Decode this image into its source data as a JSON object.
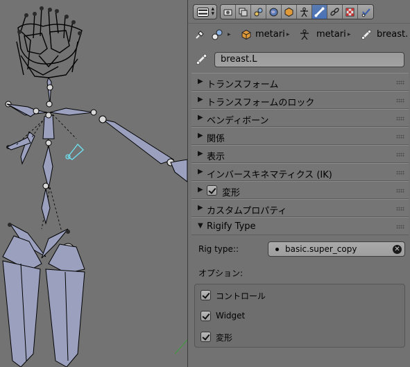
{
  "breadcrumb": {
    "object_name": "metari",
    "armature_name": "metari",
    "bone_name": "breast."
  },
  "bone_field": {
    "value": "breast.L"
  },
  "panels": [
    {
      "label": "トランスフォーム",
      "expanded": false
    },
    {
      "label": "トランスフォームのロック",
      "expanded": false
    },
    {
      "label": "ベンディボーン",
      "expanded": false
    },
    {
      "label": "関係",
      "expanded": false
    },
    {
      "label": "表示",
      "expanded": false
    },
    {
      "label": "インバースキネマティクス (IK)",
      "expanded": false
    },
    {
      "label": "変形",
      "expanded": false,
      "checked": true
    },
    {
      "label": "カスタムプロパティ",
      "expanded": false
    }
  ],
  "rigify": {
    "header": "Rigify Type",
    "rig_type_label": "Rig type::",
    "rig_type_value": "basic.super_copy",
    "options_label": "オプション:",
    "options": [
      {
        "label": "コントロール",
        "checked": true
      },
      {
        "label": "Widget",
        "checked": true
      },
      {
        "label": "変形",
        "checked": true
      }
    ]
  },
  "tabs": [
    "render-icon",
    "render-layers-icon",
    "scene-icon",
    "world-icon",
    "object-icon",
    "armature-data-icon",
    "bone-icon",
    "bone-constraints-icon",
    "texture-icon",
    "modifier-icon"
  ],
  "colors": {
    "active_tab": "#4871b8",
    "selected_bone": "#6ee0f0",
    "viewport_bg": "#737373",
    "panel_bg": "#727272"
  }
}
